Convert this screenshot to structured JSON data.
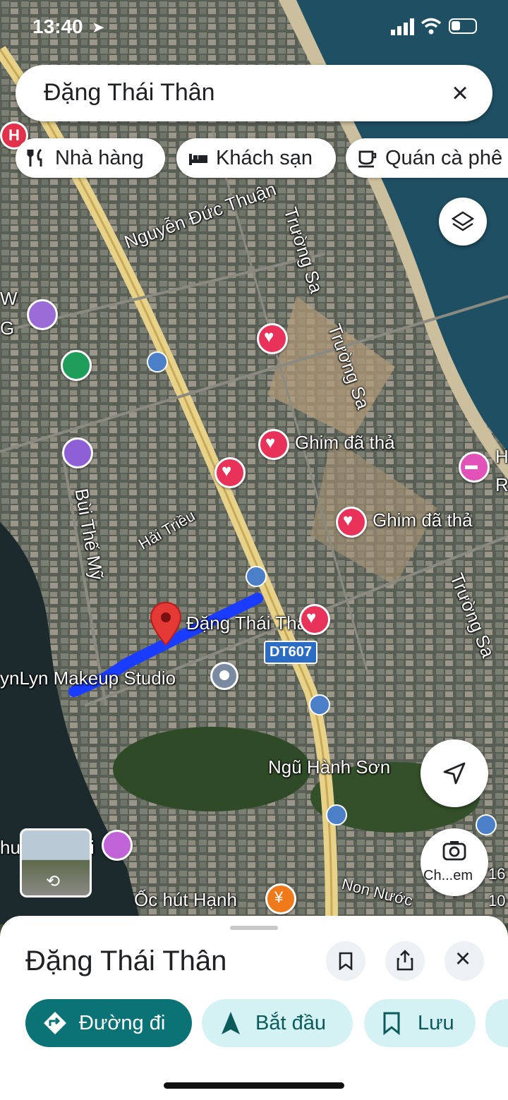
{
  "status": {
    "time": "13:40"
  },
  "search": {
    "query": "Đặng Thái Thân"
  },
  "chips": [
    "Nhà hàng",
    "Khách sạn",
    "Quán cà phê"
  ],
  "map_labels": {
    "nguyen_duc_thuan": "Nguyễn Đức Thuận",
    "truong_sa_1": "Trường Sa",
    "truong_sa_2": "Trường Sa",
    "truong_sa_3": "Trường Sa",
    "bui_the_my": "Bùi Thế Mỹ",
    "hai_trieu": "Hải Triều",
    "pin_1": "Ghim đã thả",
    "pin_2": "Ghim đã thả",
    "dang_thai_than": "Đặng Thái Thân",
    "route": "DT607",
    "makeup": "ynLyn Makeup Studio",
    "ngu_hanh_son": "Ngũ Hành Sơn",
    "oc_hut": "Ốc hút Hạnh",
    "non_nuoc": "Non Nước",
    "partial_w": "W",
    "partial_g": "G",
    "partial_h": "H",
    "partial_r": "R",
    "partial_huy": "huy",
    "partial_i": "i",
    "partial_16": "16",
    "partial_10": "10",
    "hospital": "H"
  },
  "camera_label": "Ch...em",
  "sheet": {
    "title": "Đặng Thái Thân",
    "directions": "Đường đi",
    "start": "Bắt đầu",
    "save": "Lưu"
  },
  "colors": {
    "accent": "#0b7376",
    "pin": "#e8325a",
    "route": "#1a3cff"
  }
}
